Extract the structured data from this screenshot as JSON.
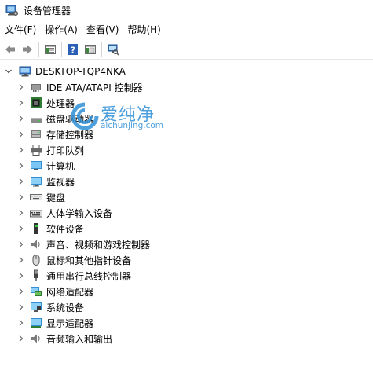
{
  "window": {
    "title": "设备管理器"
  },
  "menu": [
    "文件(F)",
    "操作(A)",
    "查看(V)",
    "帮助(H)"
  ],
  "toolbar": {
    "buttons": [
      "back-arrow-icon",
      "forward-arrow-icon",
      "properties-icon",
      "help-icon",
      "update-driver-icon",
      "scan-hardware-icon"
    ]
  },
  "tree": {
    "root": "DESKTOP-TQP4NKA",
    "items": [
      {
        "label": "IDE ATA/ATAPI 控制器",
        "icon": "ide-controller-icon"
      },
      {
        "label": "处理器",
        "icon": "processor-icon"
      },
      {
        "label": "磁盘驱动器",
        "icon": "disk-drive-icon"
      },
      {
        "label": "存储控制器",
        "icon": "storage-controller-icon"
      },
      {
        "label": "打印队列",
        "icon": "printer-icon"
      },
      {
        "label": "计算机",
        "icon": "computer-icon"
      },
      {
        "label": "监视器",
        "icon": "monitor-icon"
      },
      {
        "label": "键盘",
        "icon": "keyboard-icon"
      },
      {
        "label": "人体学输入设备",
        "icon": "hid-icon"
      },
      {
        "label": "软件设备",
        "icon": "software-device-icon"
      },
      {
        "label": "声音、视频和游戏控制器",
        "icon": "sound-icon"
      },
      {
        "label": "鼠标和其他指针设备",
        "icon": "mouse-icon"
      },
      {
        "label": "通用串行总线控制器",
        "icon": "usb-icon"
      },
      {
        "label": "网络适配器",
        "icon": "network-adapter-icon"
      },
      {
        "label": "系统设备",
        "icon": "system-device-icon"
      },
      {
        "label": "显示适配器",
        "icon": "display-adapter-icon"
      },
      {
        "label": "音频输入和输出",
        "icon": "audio-io-icon"
      }
    ]
  },
  "watermark": {
    "text": "爱纯净",
    "url": "aichunjing.com"
  }
}
